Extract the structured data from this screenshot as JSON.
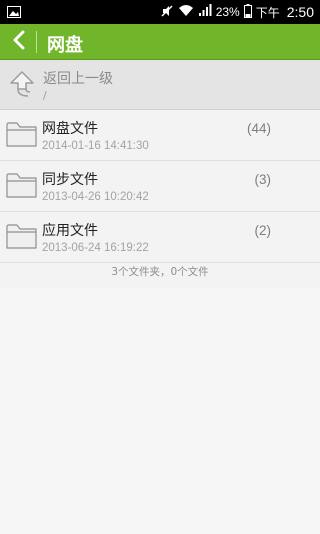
{
  "status_bar": {
    "battery": "23%",
    "period": "下午",
    "time": "2:50"
  },
  "header": {
    "title": "网盘"
  },
  "up": {
    "label": "返回上一级",
    "path": "/"
  },
  "folders": [
    {
      "name": "网盘文件",
      "date": "2014-01-16 14:41:30",
      "count": "(44)"
    },
    {
      "name": "同步文件",
      "date": "2013-04-26 10:20:42",
      "count": "(3)"
    },
    {
      "name": "应用文件",
      "date": "2013-06-24 16:19:22",
      "count": "(2)"
    }
  ],
  "summary": "3个文件夹，0个文件",
  "colors": {
    "accent": "#71b52a",
    "status_bar": "#000000"
  }
}
